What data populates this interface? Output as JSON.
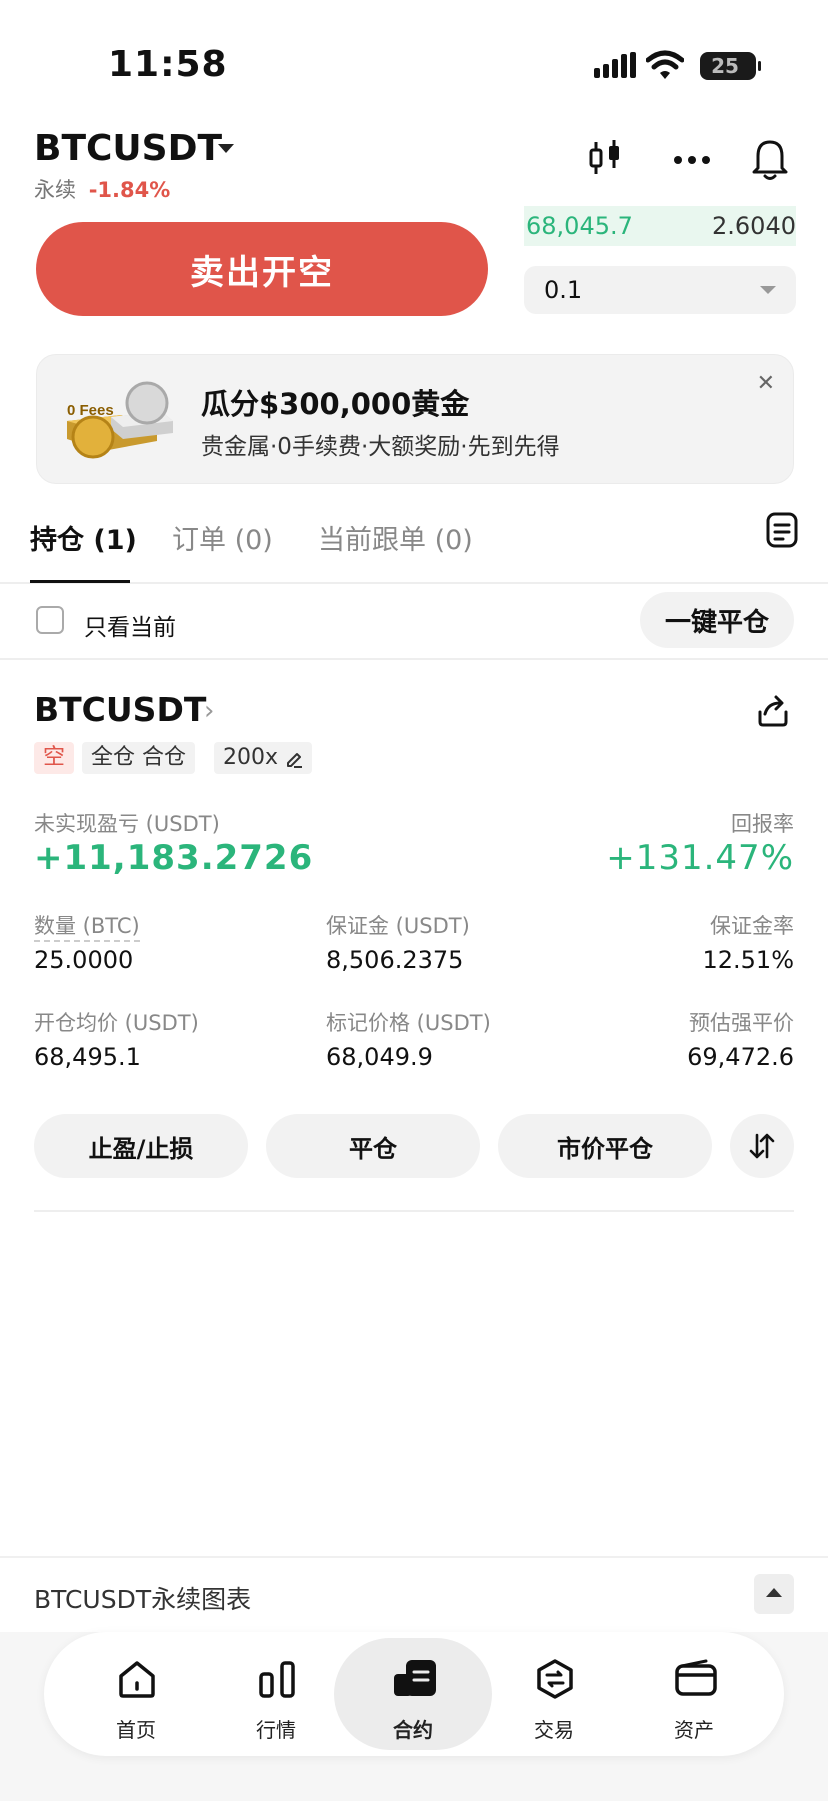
{
  "status_bar": {
    "time": "11:58",
    "battery": "25"
  },
  "header": {
    "symbol": "BTCUSDT",
    "contract_kind": "永续",
    "change": "-1.84%",
    "icons": [
      "candlestick-icon",
      "more-icon",
      "bell-icon"
    ]
  },
  "order": {
    "sell_label": "卖出开空",
    "orderbook_price": "68,045.7",
    "orderbook_qty": "2.6040",
    "qty_value": "0.1"
  },
  "promo": {
    "title": "瓜分$300,000黄金",
    "desc": "贵金属·0手续费·大额奖励·先到先得",
    "art_text": "0 Fees"
  },
  "tabs": [
    {
      "label": "持仓 (1)",
      "active": true
    },
    {
      "label": "订单 (0)",
      "active": false
    },
    {
      "label": "当前跟单 (0)",
      "active": false
    }
  ],
  "filter": {
    "only_current": "只看当前",
    "close_all": "一键平仓"
  },
  "position": {
    "symbol": "BTCUSDT",
    "tags": {
      "side": "空",
      "mode": "全仓 合仓",
      "leverage": "200x"
    },
    "pnl_label": "未实现盈亏 (USDT)",
    "pnl_value": "+11,183.2726",
    "roe_label": "回报率",
    "roe_value": "+131.47%",
    "qty_label": "数量 (BTC)",
    "qty_value": "25.0000",
    "margin_label": "保证金 (USDT)",
    "margin_value": "8,506.2375",
    "margin_ratio_label": "保证金率",
    "margin_ratio_value": "12.51%",
    "entry_label": "开仓均价 (USDT)",
    "entry_value": "68,495.1",
    "mark_label": "标记价格 (USDT)",
    "mark_value": "68,049.9",
    "liq_label": "预估强平价",
    "liq_value": "69,472.6",
    "actions": {
      "tpsl": "止盈/止损",
      "close": "平仓",
      "market_close": "市价平仓"
    }
  },
  "chart_bar": {
    "title": "BTCUSDT永续图表"
  },
  "nav": [
    {
      "label": "首页",
      "icon": "home-icon"
    },
    {
      "label": "行情",
      "icon": "market-icon"
    },
    {
      "label": "合约",
      "icon": "futures-icon",
      "active": true
    },
    {
      "label": "交易",
      "icon": "trade-icon"
    },
    {
      "label": "资产",
      "icon": "wallet-icon"
    }
  ],
  "colors": {
    "red": "#e0554a",
    "green": "#2bb57b"
  }
}
